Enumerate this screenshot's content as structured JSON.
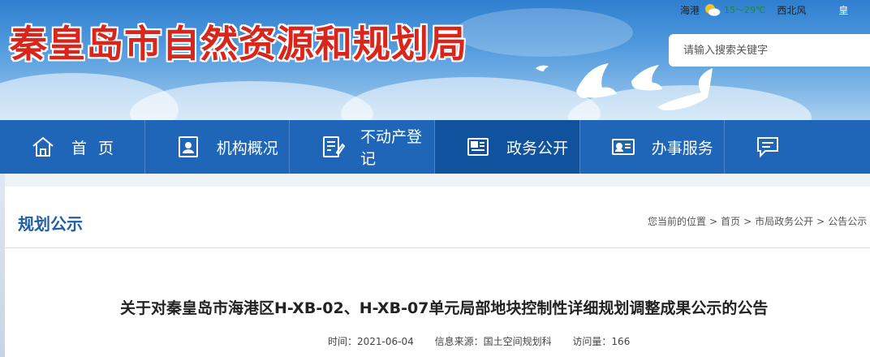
{
  "header": {
    "site_title": "秦皇岛市自然资源和规划局",
    "weather": {
      "city": "海港",
      "temperature": "15～29℃",
      "wind": "西北风",
      "more": "皇"
    },
    "search": {
      "placeholder": "请输入搜索关键字"
    }
  },
  "nav": {
    "items": [
      {
        "label": "首页",
        "icon": "home-icon"
      },
      {
        "label": "机构概况",
        "icon": "org-profile-icon"
      },
      {
        "label": "不动产登记",
        "icon": "document-edit-icon"
      },
      {
        "label": "政务公开",
        "icon": "news-list-icon"
      },
      {
        "label": "办事服务",
        "icon": "id-card-icon"
      },
      {
        "label": "",
        "icon": "chat-icon"
      }
    ],
    "active_index": 3
  },
  "section": {
    "title": "规划公示",
    "breadcrumb": {
      "prefix": "您当前的位置",
      "items": [
        "首页",
        "市局政务公开",
        "公告公示"
      ]
    }
  },
  "article": {
    "title": "关于对秦皇岛市海港区H-XB-02、H-XB-07单元局部地块控制性详细规划调整成果公示的公告",
    "time": "时间：2021-06-04",
    "source": "信息来源：国土空间规划科",
    "views": "访问量：166"
  },
  "colors": {
    "title_red": "#d8261c",
    "nav_blue": "#1f66b8",
    "nav_active": "#10529e",
    "section_title_blue": "#1f5fa8"
  }
}
